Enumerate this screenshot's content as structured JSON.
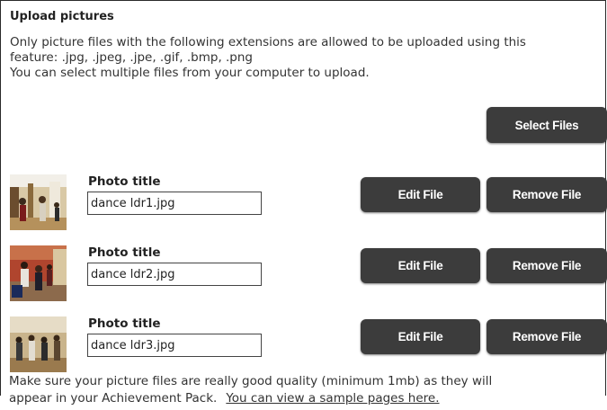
{
  "heading": "Upload pictures",
  "intro": {
    "line1": "Only picture files with the following extensions are allowed to be uploaded using this",
    "line2": "feature: .jpg, .jpeg, .jpe, .gif, .bmp, .png",
    "line3": "You can select multiple files from your computer to upload."
  },
  "select_files_label": "Select Files",
  "photo_title_label": "Photo title",
  "edit_label": "Edit File",
  "remove_label": "Remove File",
  "photos": [
    {
      "title": "dance ldr1.jpg"
    },
    {
      "title": "dance ldr2.jpg"
    },
    {
      "title": "dance ldr3.jpg"
    }
  ],
  "footer": {
    "line1": "Make sure your picture files are really good quality (minimum 1mb) as they will",
    "line2": "appear in your Achievement Pack.",
    "link": "You can view a sample pages here."
  },
  "colors": {
    "button_bg": "#3c3c3c",
    "button_text": "#ffffff"
  }
}
